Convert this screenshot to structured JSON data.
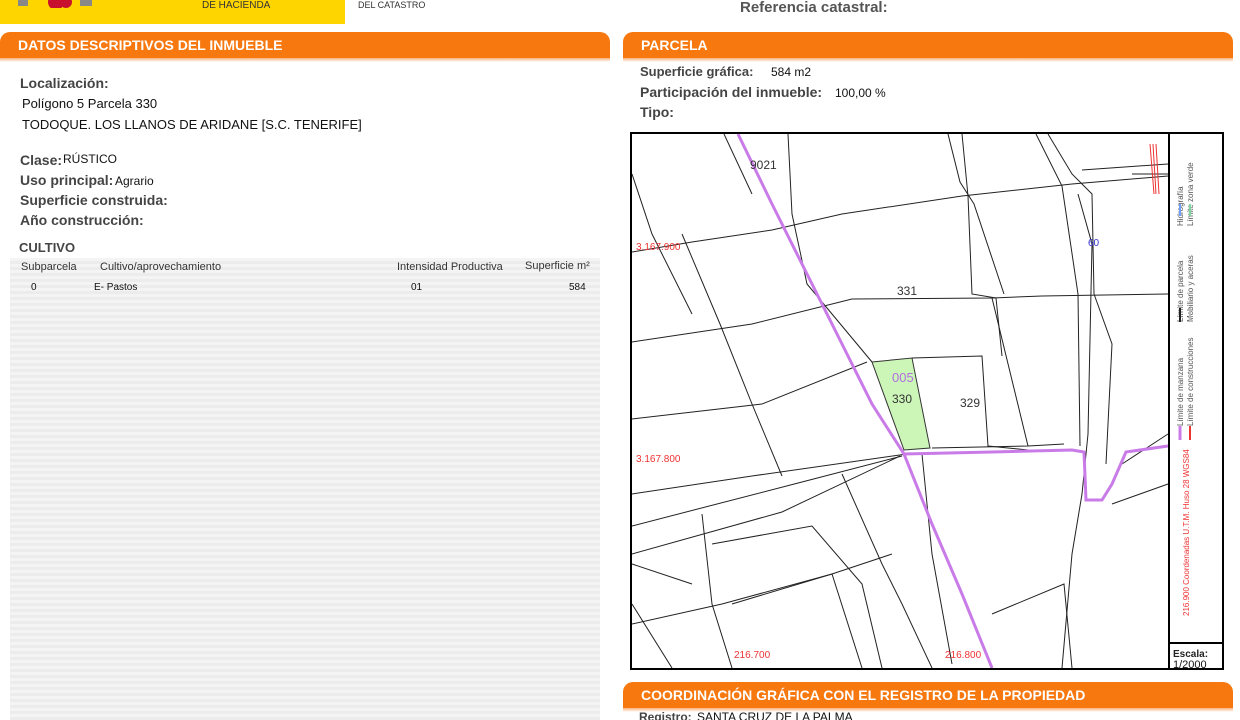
{
  "header": {
    "org_line": "DE HACIENDA",
    "dept_line": "DEL CATASTRO",
    "ref_label": "Referencia catastral:"
  },
  "left": {
    "section_title": "DATOS DESCRIPTIVOS DEL INMUEBLE",
    "localizacion_label": "Localización:",
    "localizacion_1": "Polígono 5 Parcela 330",
    "localizacion_2": "TODOQUE. LOS LLANOS DE ARIDANE [S.C. TENERIFE]",
    "clase_label": "Clase:",
    "clase_value": "RÚSTICO",
    "uso_label": "Uso principal:",
    "uso_value": "Agrario",
    "superficie_label": "Superficie construida:",
    "anio_label": "Año construcción:",
    "cultivo_title": "CULTIVO",
    "table": {
      "headers": [
        "Subparcela",
        "Cultivo/aprovechamiento",
        "Intensidad Productiva",
        "Superficie m²"
      ],
      "rows": [
        [
          "0",
          "E- Pastos",
          "01",
          "584"
        ]
      ]
    }
  },
  "right": {
    "section_title": "PARCELA",
    "sup_grafica_label": "Superficie gráfica:",
    "sup_grafica_value": "584 m2",
    "participacion_label": "Participación del inmueble:",
    "participacion_value": "100,00 %",
    "tipo_label": "Tipo:",
    "map": {
      "parcel_labels": [
        "9021",
        "331",
        "330",
        "329",
        "005",
        "60"
      ],
      "coord_labels": [
        "3.167.900",
        "3.167.800",
        "216.700",
        "216.800"
      ],
      "legend": [
        "Hidrografía",
        "Límite zona verde",
        "Límite de parcela",
        "Mobiliario y aceras",
        "Límite de manzana",
        "Límite de construcciones"
      ],
      "coord_note": "216.900 Coordenadas U.T.M. Huso 28 WGS84",
      "scale_label": "Escala:",
      "scale_value": "1/2000"
    },
    "coord_section_title": "COORDINACIÓN GRÁFICA CON EL REGISTRO DE LA PROPIEDAD",
    "registro_label": "Registro:",
    "registro_value": "SANTA CRUZ DE LA PALMA"
  },
  "colors": {
    "accent": "#f7780f",
    "logo_yellow": "#ffd500",
    "parcel_fill": "#ccf5b8",
    "boundary": "#c97be8"
  }
}
